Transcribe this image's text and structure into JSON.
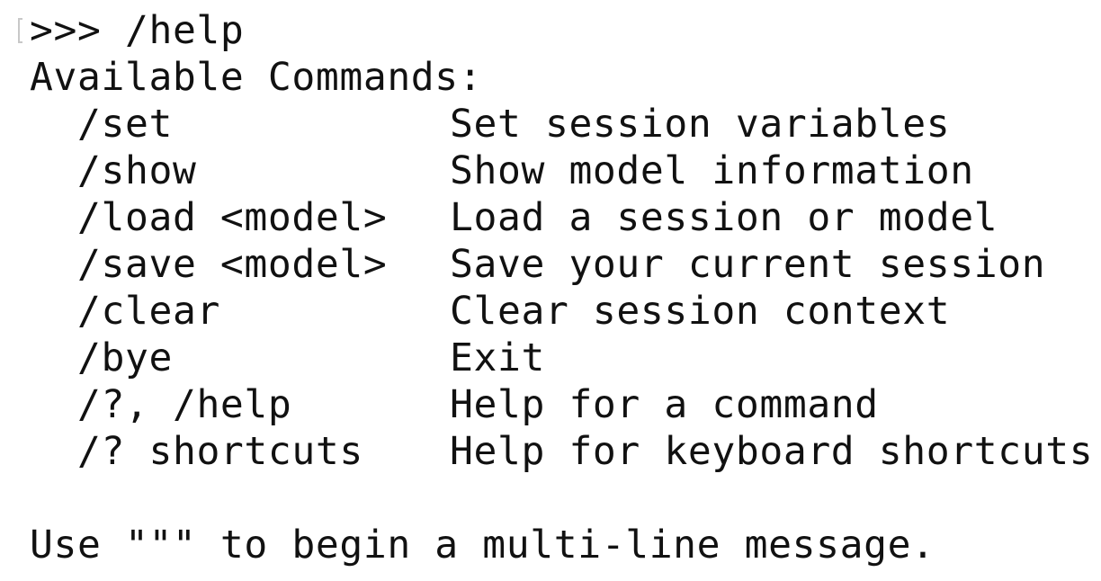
{
  "terminal": {
    "prompt": ">>>",
    "input": "/help",
    "header": "Available Commands:",
    "commands": [
      {
        "command": "/set",
        "description": "Set session variables"
      },
      {
        "command": "/show",
        "description": "Show model information"
      },
      {
        "command": "/load <model>",
        "description": "Load a session or model"
      },
      {
        "command": "/save <model>",
        "description": "Save your current session"
      },
      {
        "command": "/clear",
        "description": "Clear session context"
      },
      {
        "command": "/bye",
        "description": "Exit"
      },
      {
        "command": "/?, /help",
        "description": "Help for a command"
      },
      {
        "command": "/? shortcuts",
        "description": "Help for keyboard shortcuts"
      }
    ],
    "footer": "Use \"\"\" to begin a multi-line message."
  }
}
